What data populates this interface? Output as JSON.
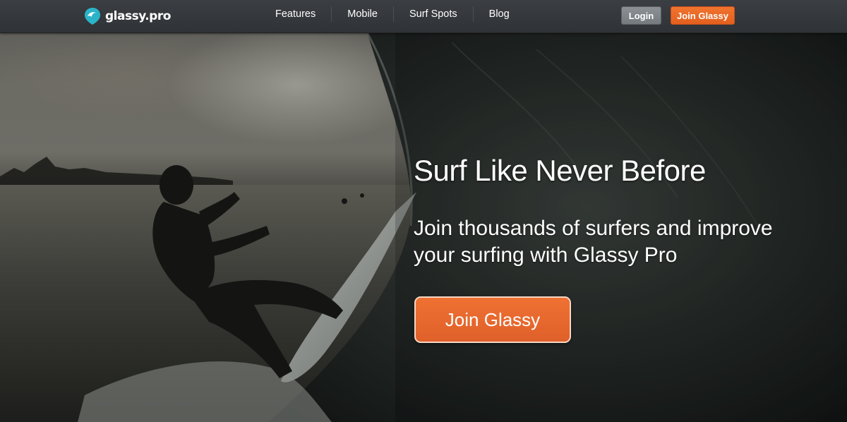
{
  "brand": {
    "name": "glassy.pro",
    "icon": "map-pin-wave-icon",
    "accent_color": "#2bb3c9"
  },
  "nav": {
    "links": [
      {
        "label": "Features"
      },
      {
        "label": "Mobile"
      },
      {
        "label": "Surf Spots"
      },
      {
        "label": "Blog"
      }
    ],
    "login_label": "Login",
    "join_label": "Join Glassy"
  },
  "hero": {
    "headline": "Surf Like Never Before",
    "subheadline": "Join thousands of surfers and improve your surfing with Glassy Pro",
    "cta_label": "Join Glassy",
    "cta_color": "#e8672a"
  }
}
